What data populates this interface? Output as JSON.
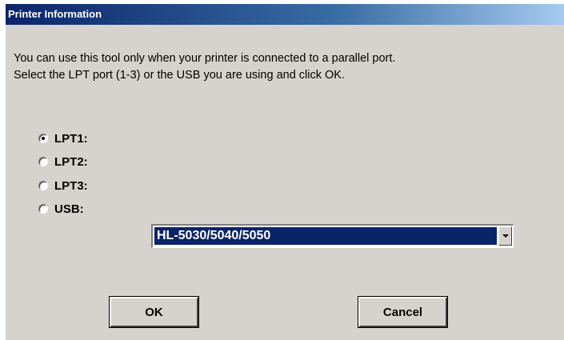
{
  "window": {
    "title": "Printer Information"
  },
  "description": {
    "line1": "You can use this tool only when your printer is connected to a parallel port.",
    "line2": "Select the LPT port (1-3) or the USB you are using and click OK."
  },
  "ports": [
    {
      "label": "LPT1:",
      "selected": true
    },
    {
      "label": "LPT2:",
      "selected": false
    },
    {
      "label": "LPT3:",
      "selected": false
    },
    {
      "label": "USB:",
      "selected": false
    }
  ],
  "printer_select": {
    "value": "HL-5030/5040/5050",
    "selected_bg": "#0a246a"
  },
  "buttons": {
    "ok_label": "OK",
    "cancel_label": "Cancel"
  },
  "colors": {
    "dialog_bg": "#d6d3ce",
    "titlebar_start": "#0a246a",
    "titlebar_end": "#a6caf0"
  },
  "icons": {
    "dropdown": "chevron-down-icon"
  }
}
